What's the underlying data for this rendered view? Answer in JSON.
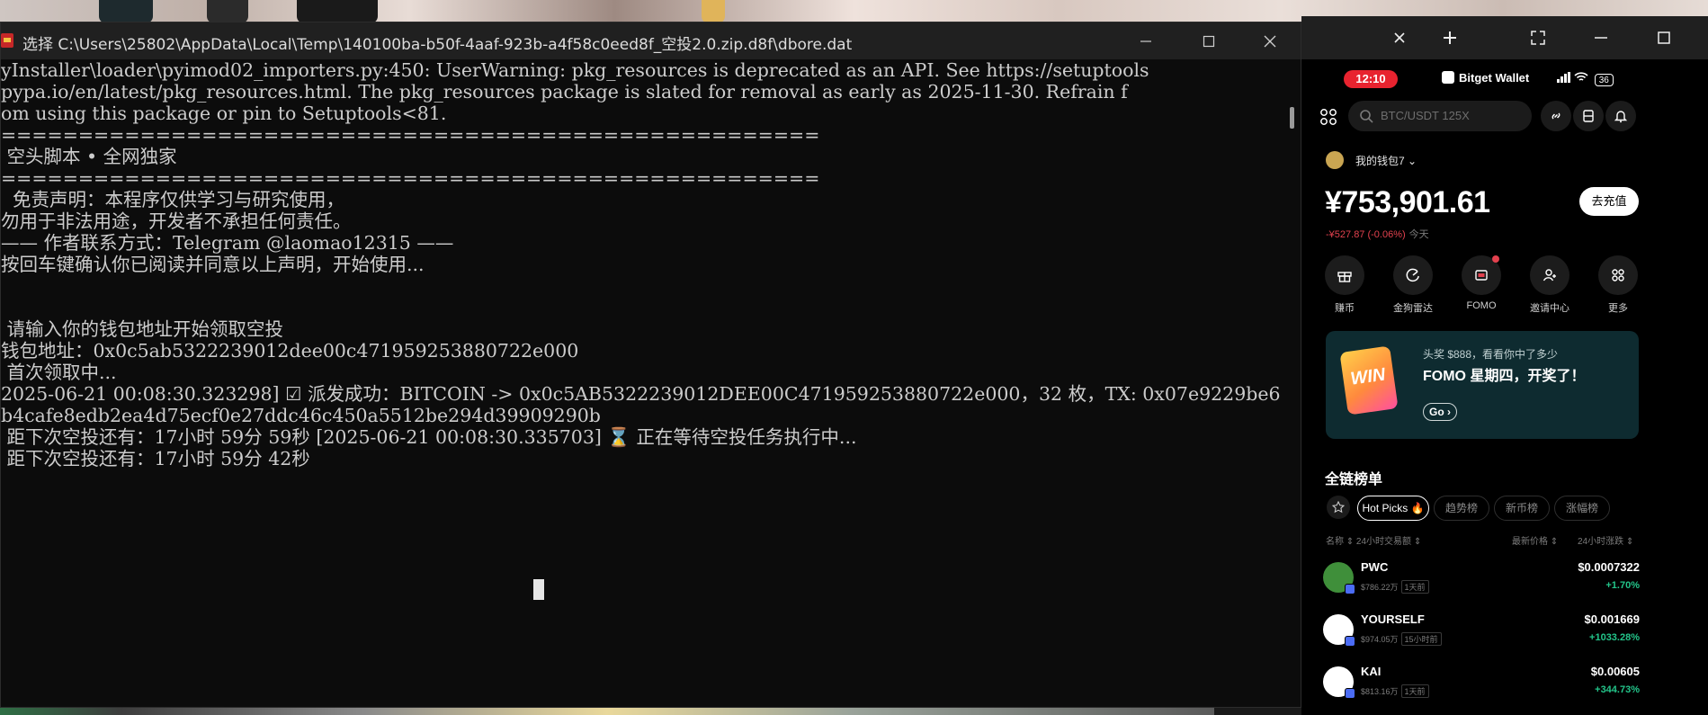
{
  "console": {
    "title": "选择 C:\\Users\\25802\\AppData\\Local\\Temp\\140100ba-b50f-4aaf-923b-a4f58c0eed8f_空投2.0.zip.d8f\\dbore.dat",
    "lines": [
      "yInstaller\\loader\\pyimod02_importers.py:450: UserWarning: pkg_resources is deprecated as an API. See https://setuptools",
      "pypa.io/en/latest/pkg_resources.html. The pkg_resources package is slated for removal as early as 2025-11-30. Refrain f",
      "om using this package or pin to Setuptools<81.",
      "=====================================================",
      " 空头脚本 • 全网独家",
      "=====================================================",
      "  免责声明：本程序仅供学习与研究使用，",
      "勿用于非法用途，开发者不承担任何责任。",
      "—— 作者联系方式：Telegram @laomao12315 ——",
      "按回车键确认你已阅读并同意以上声明，开始使用...",
      "",
      "",
      " 请输入你的钱包地址开始领取空投",
      "钱包地址：0x0c5ab5322239012dee00c471959253880722e000",
      " 首次领取中...",
      "2025-06-21 00:08:30.323298] ☑ 派发成功：BITCOIN -> 0x0c5AB5322239012DEE00C471959253880722e000，32 枚，TX: 0x07e9229be6",
      "b4cafe8edb2ea4d75ecf0e27ddc46c450a5512be294d39909290b",
      " 距下次空投还有：17小时 59分 59秒 [2025-06-21 00:08:30.335703] ⌛ 正在等待空投任务执行中...",
      " 距下次空投还有：17小时 59分 42秒"
    ]
  },
  "side_toolbar": {
    "icons": [
      "close-icon",
      "plus-icon",
      "expand-icon",
      "minimize-icon",
      "maximize-icon"
    ]
  },
  "wallet": {
    "status": {
      "time": "12:10",
      "brand": "Bitget Wallet",
      "battery": "36"
    },
    "search": {
      "placeholder": "BTC/USDT 125X"
    },
    "account": {
      "name": "我的钱包7",
      "balance": "¥753,901.61",
      "change": "-¥527.87 (-0.06%)",
      "change_period": "今天",
      "deposit_label": "去充值"
    },
    "quick_actions": [
      {
        "label": "赚币",
        "icon": "gift-icon"
      },
      {
        "label": "金狗雷达",
        "icon": "radar-icon"
      },
      {
        "label": "FOMO",
        "icon": "fomo-icon"
      },
      {
        "label": "邀请中心",
        "icon": "invite-icon"
      },
      {
        "label": "更多",
        "icon": "grid-icon"
      }
    ],
    "promo": {
      "art_text": "WIN",
      "kicker": "头奖 $888，看看你中了多少",
      "title": "FOMO 星期四，开奖了！",
      "cta": "Go ›"
    },
    "rankings": {
      "title": "全链榜单",
      "tabs": [
        "Hot Picks 🔥",
        "趋势榜",
        "新币榜",
        "涨幅榜"
      ],
      "columns": {
        "name": "名称 ⇕ 24小时交易额 ⇕",
        "price": "最新价格 ⇕",
        "change": "24小时涨跌 ⇕"
      },
      "tokens": [
        {
          "name": "PWC",
          "volume": "$786.22万",
          "age": "1天前",
          "price": "$0.0007322",
          "change": "+1.70%",
          "color": "#3f8f3a"
        },
        {
          "name": "YOURSELF",
          "volume": "$974.05万",
          "age": "15小时前",
          "price": "$0.001669",
          "change": "+1033.28%",
          "color": "#ffffff"
        },
        {
          "name": "KAI",
          "volume": "$813.16万",
          "age": "1天前",
          "price": "$0.00605",
          "change": "+344.73%",
          "color": "#ffffff"
        }
      ]
    }
  }
}
